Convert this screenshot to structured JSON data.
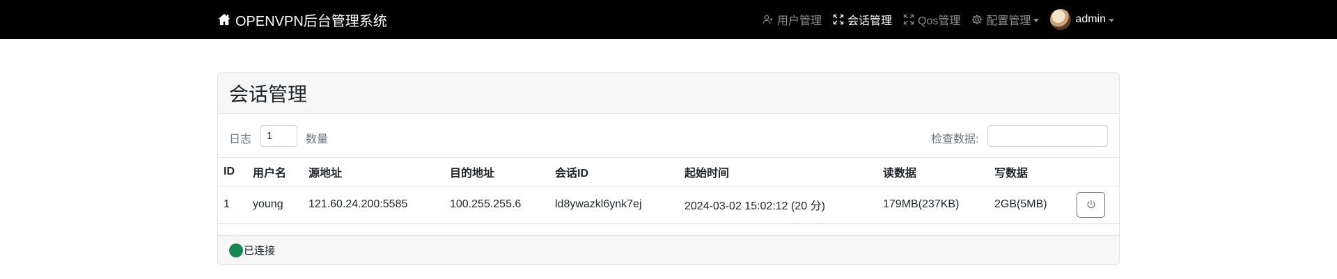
{
  "brand": {
    "title": "OPENVPN后台管理系统",
    "icon": "home-icon"
  },
  "nav": {
    "items": [
      {
        "label": "用户管理",
        "icon": "user-plus-icon",
        "active": false
      },
      {
        "label": "会话管理",
        "icon": "fullscreen-icon",
        "active": true
      },
      {
        "label": "Qos管理",
        "icon": "fullscreen-icon",
        "active": false
      },
      {
        "label": "配置管理",
        "icon": "gear-icon",
        "active": false
      }
    ],
    "user": {
      "name": "admin"
    }
  },
  "page": {
    "title": "会话管理",
    "log_label": "日志",
    "count_value": "1",
    "count_label": "数量",
    "search_label": "检查数据:",
    "search_value": ""
  },
  "table": {
    "headers": [
      "ID",
      "用户名",
      "源地址",
      "目的地址",
      "会话ID",
      "起始时间",
      "读数据",
      "写数据"
    ],
    "rows": [
      [
        "1",
        "young",
        "121.60.24.200:5585",
        "100.255.255.6",
        "ld8ywazkl6ynk7ej",
        "2024-03-02 15:02:12 (20 分)",
        "179MB(237KB)",
        "2GB(5MB)"
      ]
    ]
  },
  "status": {
    "text": "已连接",
    "color": "#198754"
  },
  "colors": {
    "navbar": "#000000",
    "header_bg": "#f7f7f7",
    "border": "#dee2e6"
  }
}
